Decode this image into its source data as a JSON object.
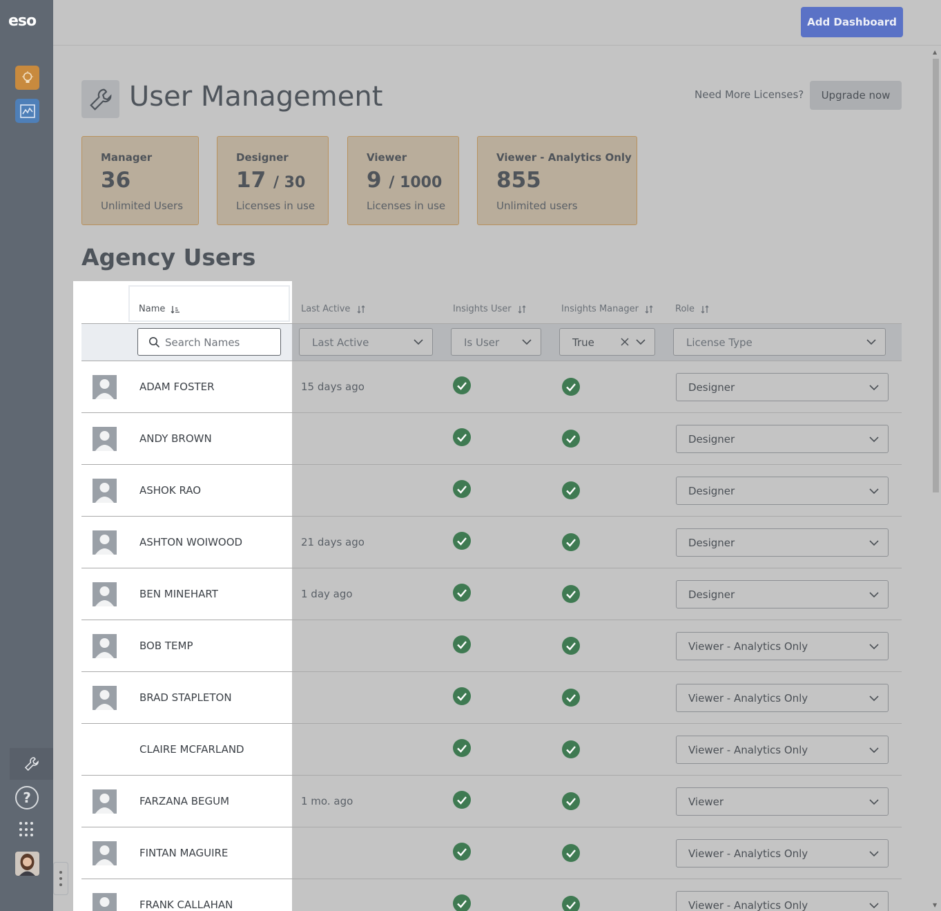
{
  "app": {
    "logo": "eso"
  },
  "topbar": {
    "add_dashboard_label": "Add Dashboard"
  },
  "header": {
    "title": "User Management",
    "need_more_text": "Need More Licenses?",
    "upgrade_label": "Upgrade now"
  },
  "cards": [
    {
      "title": "Manager",
      "count": "36",
      "total": "",
      "sub": "Unlimited Users"
    },
    {
      "title": "Designer",
      "count": "17",
      "total": "/ 30",
      "sub": "Licenses in use"
    },
    {
      "title": "Viewer",
      "count": "9",
      "total": "/ 1000",
      "sub": "Licenses in use"
    },
    {
      "title": "Viewer - Analytics Only",
      "count": "855",
      "total": "",
      "sub": "Unlimited users"
    }
  ],
  "section_title": "Agency Users",
  "table": {
    "headers": {
      "name": "Name",
      "last_active": "Last Active",
      "insights_user": "Insights User",
      "insights_manager": "Insights Manager",
      "role": "Role"
    },
    "filters": {
      "search_placeholder": "Search Names",
      "last_active": "Last Active",
      "insights_user": "Is User",
      "insights_manager": "True",
      "role": "License Type"
    },
    "rows": [
      {
        "name": "ADAM FOSTER",
        "last_active": "15 days ago",
        "role": "Designer"
      },
      {
        "name": "ANDY BROWN",
        "last_active": "",
        "role": "Designer"
      },
      {
        "name": "ASHOK RAO",
        "last_active": "",
        "role": "Designer"
      },
      {
        "name": "ASHTON WOIWOOD",
        "last_active": "21 days ago",
        "role": "Designer"
      },
      {
        "name": "BEN MINEHART",
        "last_active": "1 day ago",
        "role": "Designer"
      },
      {
        "name": "BOB TEMP",
        "last_active": "",
        "role": "Viewer - Analytics Only"
      },
      {
        "name": "BRAD STAPLETON",
        "last_active": "",
        "role": "Viewer - Analytics Only"
      },
      {
        "name": "CLAIRE MCFARLAND",
        "last_active": "",
        "role": "Viewer - Analytics Only"
      },
      {
        "name": "FARZANA BEGUM",
        "last_active": "1 mo. ago",
        "role": "Viewer"
      },
      {
        "name": "FINTAN MAGUIRE",
        "last_active": "",
        "role": "Viewer - Analytics Only"
      },
      {
        "name": "FRANK CALLAHAN",
        "last_active": "",
        "role": "Viewer - Analytics Only"
      }
    ]
  },
  "colors": {
    "accent": "#5a72c6",
    "check": "#3f7a52",
    "card_border": "#b8915d"
  }
}
